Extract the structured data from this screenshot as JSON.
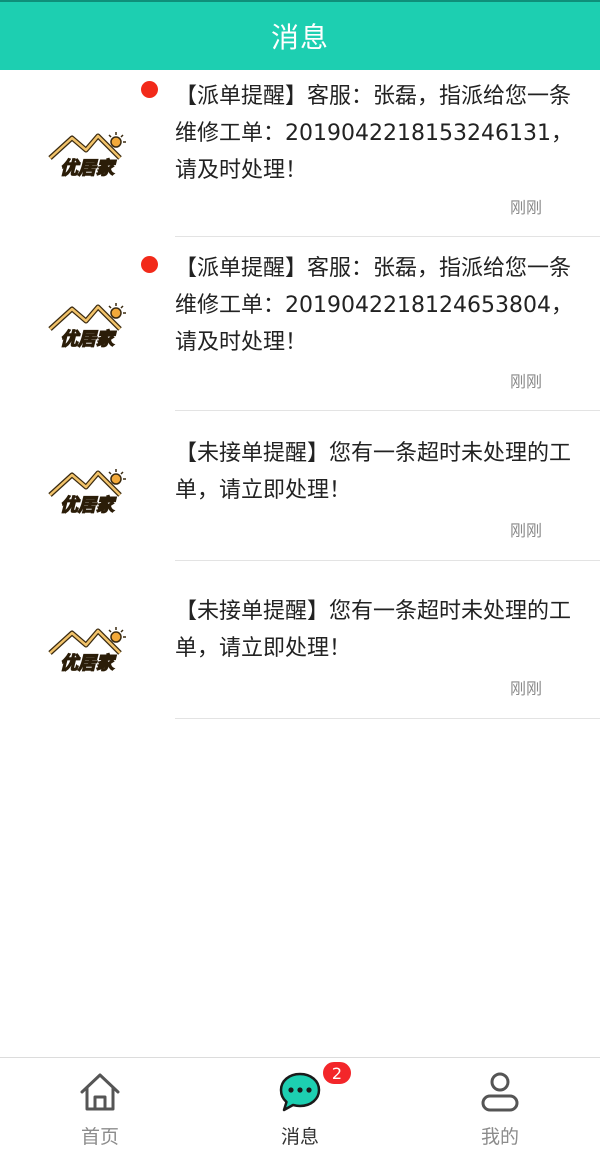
{
  "header": {
    "title": "消息"
  },
  "messages": [
    {
      "text": "【派单提醒】客服：张磊，指派给您一条维修工单：2019042218153246131，请及时处理！",
      "time": "刚刚",
      "unread": true,
      "logo_text": "优居家"
    },
    {
      "text": "【派单提醒】客服：张磊，指派给您一条维修工单：2019042218124653804，请及时处理！",
      "time": "刚刚",
      "unread": true,
      "logo_text": "优居家"
    },
    {
      "text": "【未接单提醒】您有一条超时未处理的工单，请立即处理！",
      "time": "刚刚",
      "unread": false,
      "logo_text": "优居家"
    },
    {
      "text": "【未接单提醒】您有一条超时未处理的工单，请立即处理！",
      "time": "刚刚",
      "unread": false,
      "logo_text": "优居家"
    }
  ],
  "tabbar": {
    "home": {
      "label": "首页",
      "icon": "home-icon"
    },
    "messages": {
      "label": "消息",
      "icon": "chat-bubble-icon",
      "badge": "2"
    },
    "mine": {
      "label": "我的",
      "icon": "user-icon"
    }
  },
  "colors": {
    "accent": "#1dcfb1",
    "unread_dot": "#f22a1a",
    "badge": "#f3262a"
  }
}
